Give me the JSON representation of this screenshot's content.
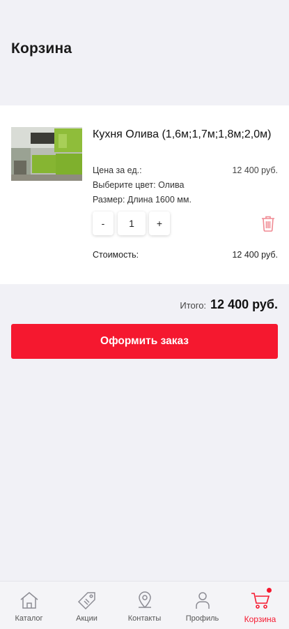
{
  "header": {
    "title": "Корзина"
  },
  "cart": {
    "item": {
      "title": "Кухня Олива (1,6м;1,7м;1,8м;2,0м)",
      "unit_price_label": "Цена за ед.:",
      "unit_price": "12 400 руб.",
      "color_label": "Выберите цвет: Олива",
      "size_label": "Размер: Длина 1600 мм.",
      "minus": "-",
      "quantity": "1",
      "plus": "+",
      "cost_label": "Стоимость:",
      "cost": "12 400 руб."
    },
    "total_label": "Итого:",
    "total": "12 400 руб.",
    "order_button": "Оформить заказ"
  },
  "tabbar": {
    "items": [
      {
        "label": "Каталог",
        "icon": "home-icon"
      },
      {
        "label": "Акции",
        "icon": "tag-icon"
      },
      {
        "label": "Контакты",
        "icon": "map-pin-icon"
      },
      {
        "label": "Профиль",
        "icon": "user-icon"
      },
      {
        "label": "Корзина",
        "icon": "cart-icon",
        "active": true
      }
    ]
  },
  "colors": {
    "accent": "#f5182f",
    "background": "#f1f1f6",
    "card": "#ffffff"
  }
}
